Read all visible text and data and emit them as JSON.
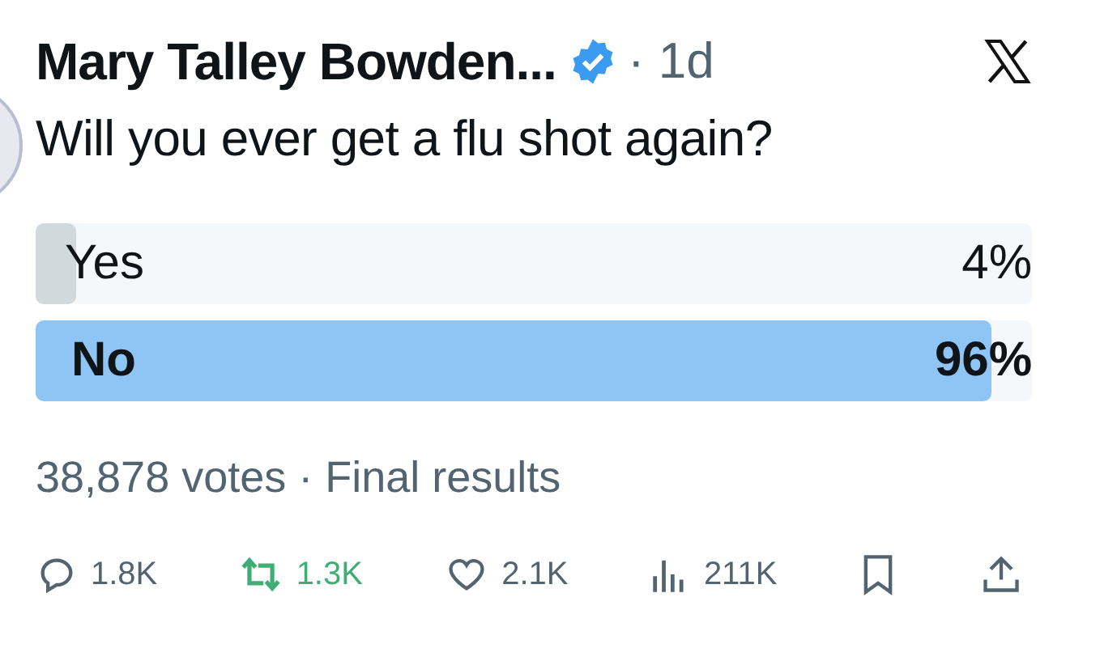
{
  "tweet": {
    "author": "Mary Talley Bowden...",
    "verified": true,
    "time": "· 1d",
    "text": "Will you ever get a flu shot again?"
  },
  "poll": {
    "options": [
      {
        "label": "Yes",
        "percent": "4%",
        "level": 0.04,
        "winner": false
      },
      {
        "label": "No",
        "percent": "96%",
        "level": 0.96,
        "winner": true
      }
    ],
    "summary": "38,878 votes · Final results"
  },
  "actions": [
    {
      "kind": "reply",
      "count": "1.8K",
      "active": false
    },
    {
      "kind": "repost",
      "count": "1.3K",
      "active": true
    },
    {
      "kind": "like",
      "count": "2.1K",
      "active": false
    },
    {
      "kind": "views",
      "count": "211K",
      "active": false
    },
    {
      "kind": "bookmark",
      "active": false
    },
    {
      "kind": "share",
      "active": false
    }
  ]
}
